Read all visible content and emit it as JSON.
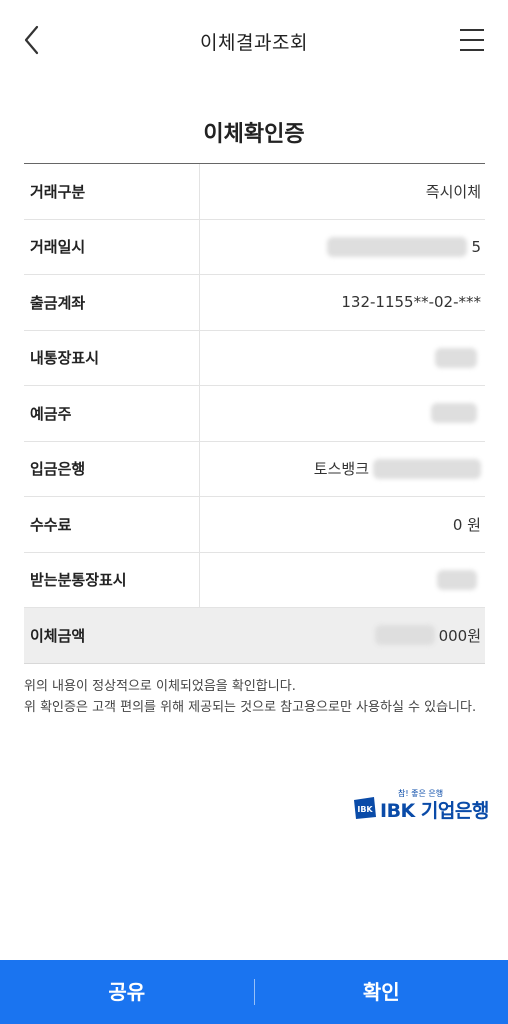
{
  "header": {
    "title": "이체결과조회",
    "back_icon": "chevron-left-icon",
    "menu_icon": "hamburger-menu-icon"
  },
  "certificate": {
    "title": "이체확인증",
    "rows": [
      {
        "label": "거래구분",
        "value": "즉시이체"
      },
      {
        "label": "거래일시",
        "value": "5"
      },
      {
        "label": "출금계좌",
        "value": "132-1155**-02-***"
      },
      {
        "label": "내통장표시",
        "value": ""
      },
      {
        "label": "예금주",
        "value": ""
      },
      {
        "label": "입금은행",
        "value": "토스뱅크"
      },
      {
        "label": "수수료",
        "value": "0 원"
      },
      {
        "label": "받는분통장표시",
        "value": ""
      },
      {
        "label": "이체금액",
        "value": "000원"
      }
    ]
  },
  "notice": {
    "line1": "위의 내용이 정상적으로 이체되었음을 확인합니다.",
    "line2": "위 확인증은 고객 편의를 위해 제공되는 것으로 참고용으로만 사용하실 수 있습니다."
  },
  "logo": {
    "slogan": "참! 좋은 은행",
    "text": "IBK 기업은행",
    "color": "#0a4ba8"
  },
  "bottom": {
    "share_label": "공유",
    "confirm_label": "확인",
    "color": "#1a74f0"
  }
}
